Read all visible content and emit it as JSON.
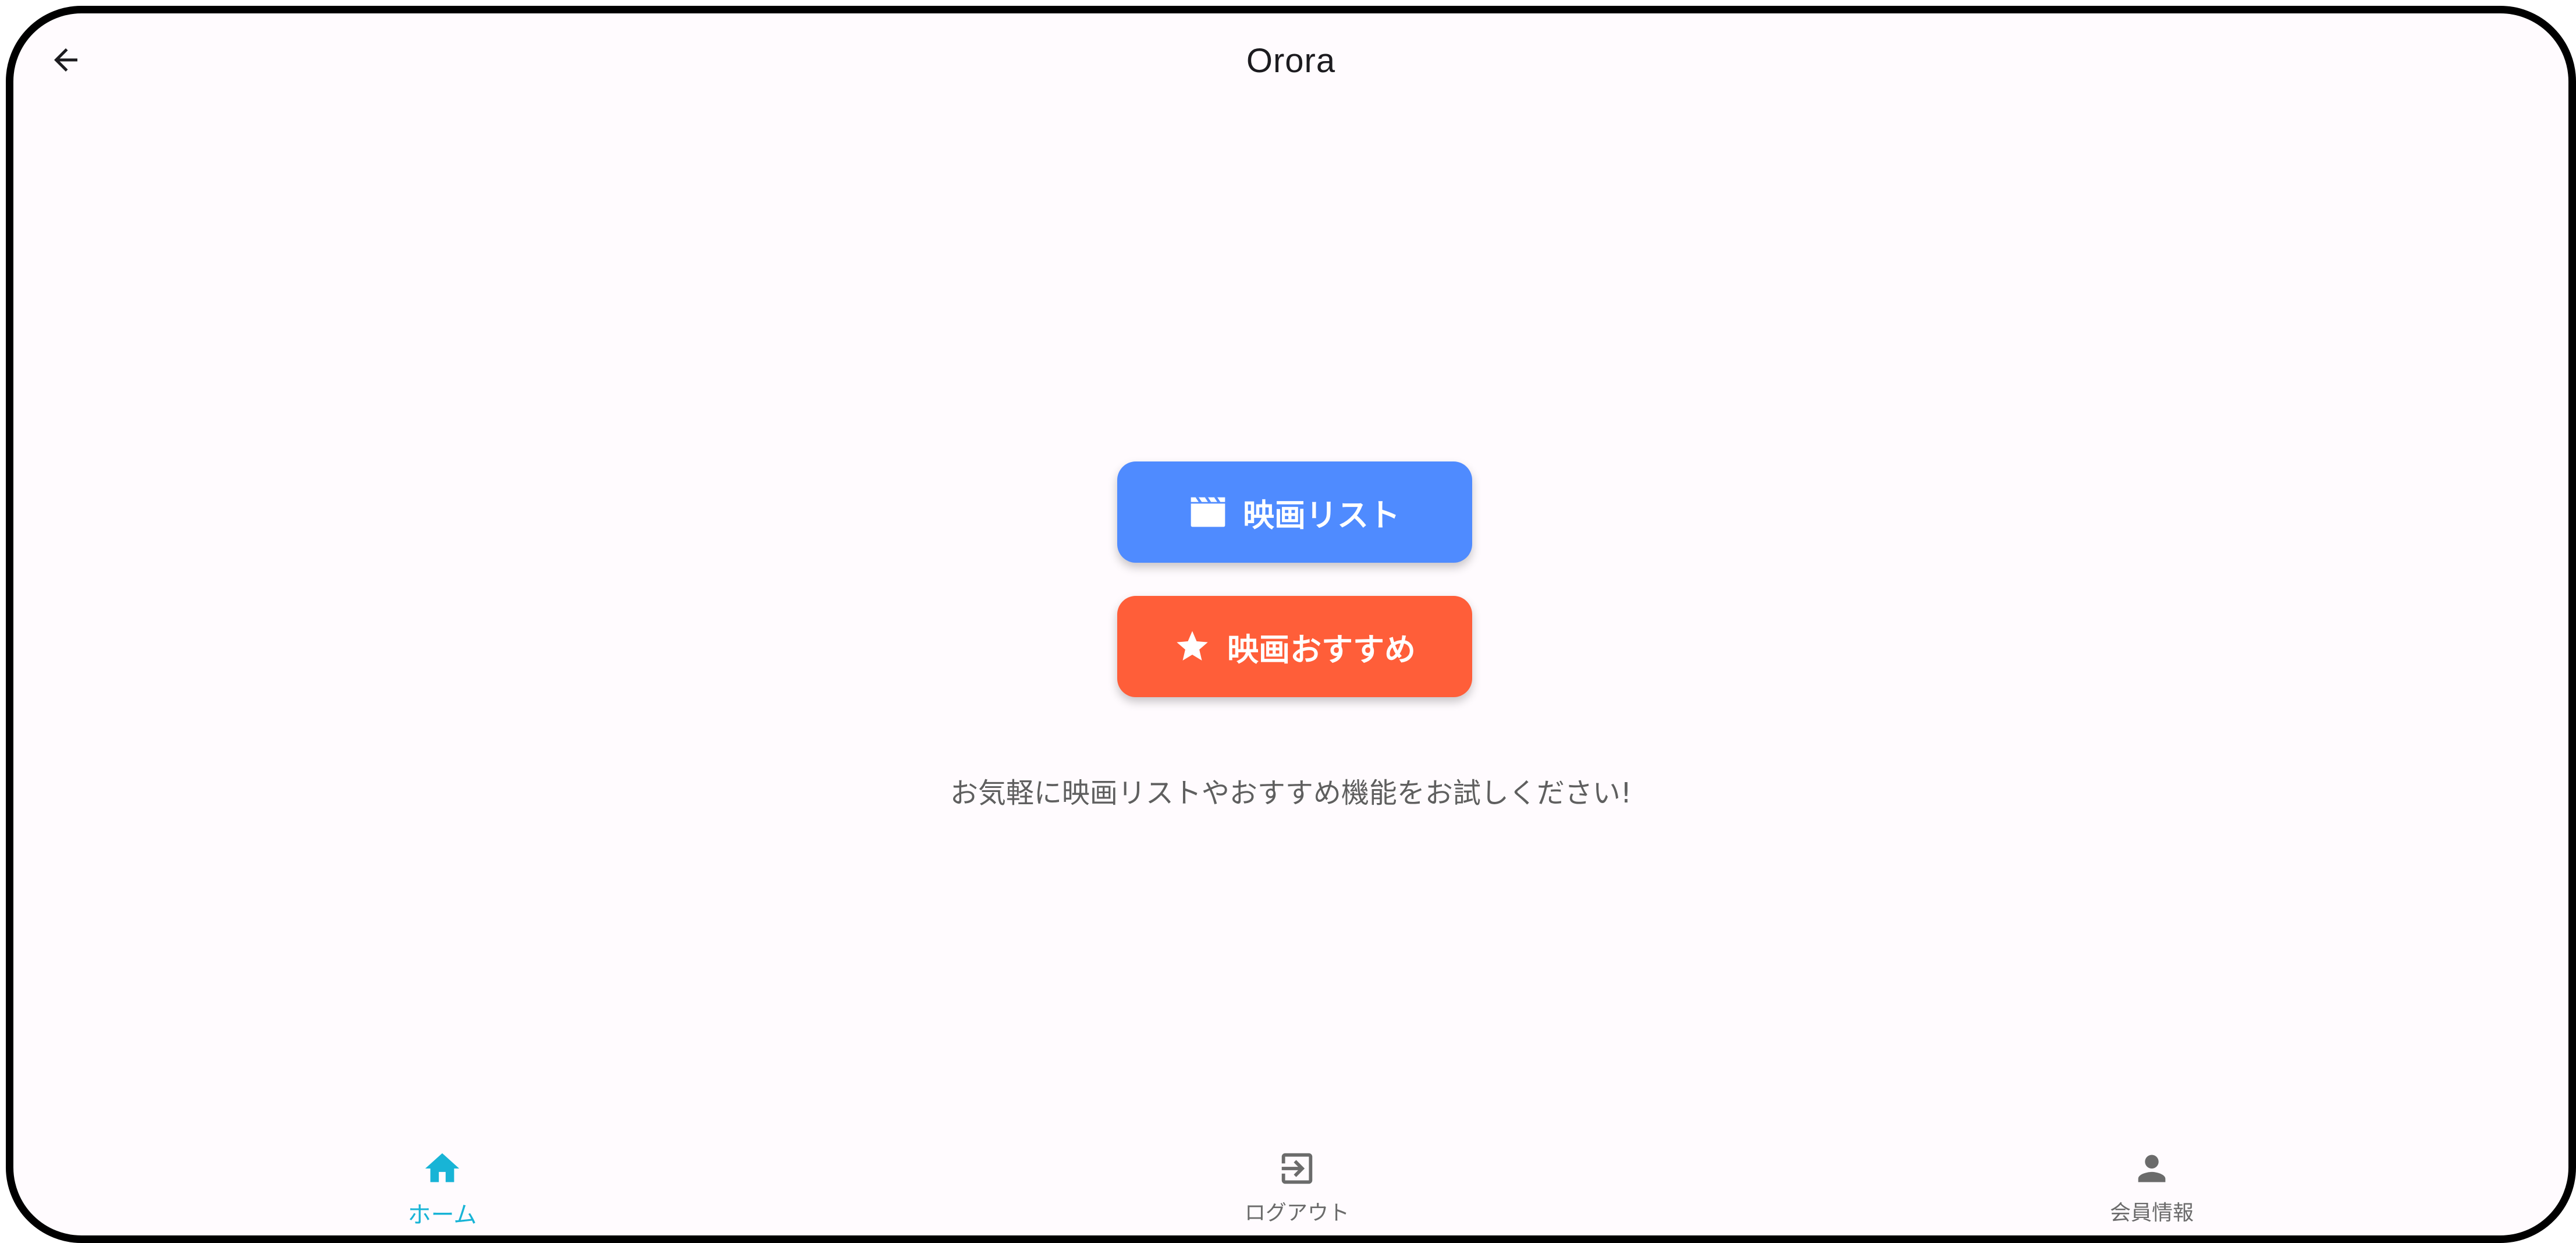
{
  "app_bar": {
    "title": "Orora",
    "back_icon": "arrow-back-icon"
  },
  "actions": {
    "movie_list": {
      "label": "映画リスト",
      "icon": "clapperboard-icon",
      "color": "#4f8bff"
    },
    "recommend": {
      "label": "映画おすすめ",
      "icon": "star-icon",
      "color": "#ff5e39"
    }
  },
  "tagline": "お気軽に映画リストやおすすめ機能をお試しください!",
  "bottom_nav": {
    "items": [
      {
        "label": "ホーム",
        "icon": "home-icon",
        "active": true
      },
      {
        "label": "ログアウト",
        "icon": "logout-icon",
        "active": false
      },
      {
        "label": "会員情報",
        "icon": "person-icon",
        "active": false
      }
    ],
    "active_color": "#18b4d6",
    "inactive_color": "#6b6b6b"
  }
}
